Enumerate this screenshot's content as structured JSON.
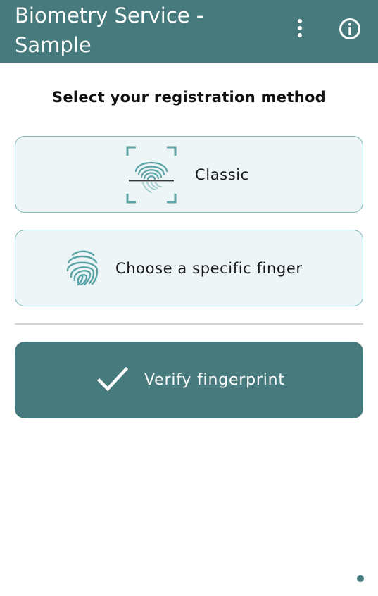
{
  "appbar": {
    "title_line1": "Biometry Service -",
    "title_line2": "Sample",
    "background_color": "#467a7c",
    "menu_icon": "more-vertical-icon",
    "info_icon": "info-icon"
  },
  "main": {
    "heading": "Select your registration method",
    "options": [
      {
        "label": "Classic",
        "icon": "fingerprint-scan-icon"
      },
      {
        "label": "Choose a specific finger",
        "icon": "fingerprint-icon"
      }
    ],
    "verify": {
      "label": "Verify fingerprint",
      "icon": "checkmark-icon"
    }
  },
  "colors": {
    "accent": "#467a7c",
    "card_border": "#7bb6b8",
    "card_background": "#eef5f7",
    "icon_teal": "#5aa4a6"
  }
}
